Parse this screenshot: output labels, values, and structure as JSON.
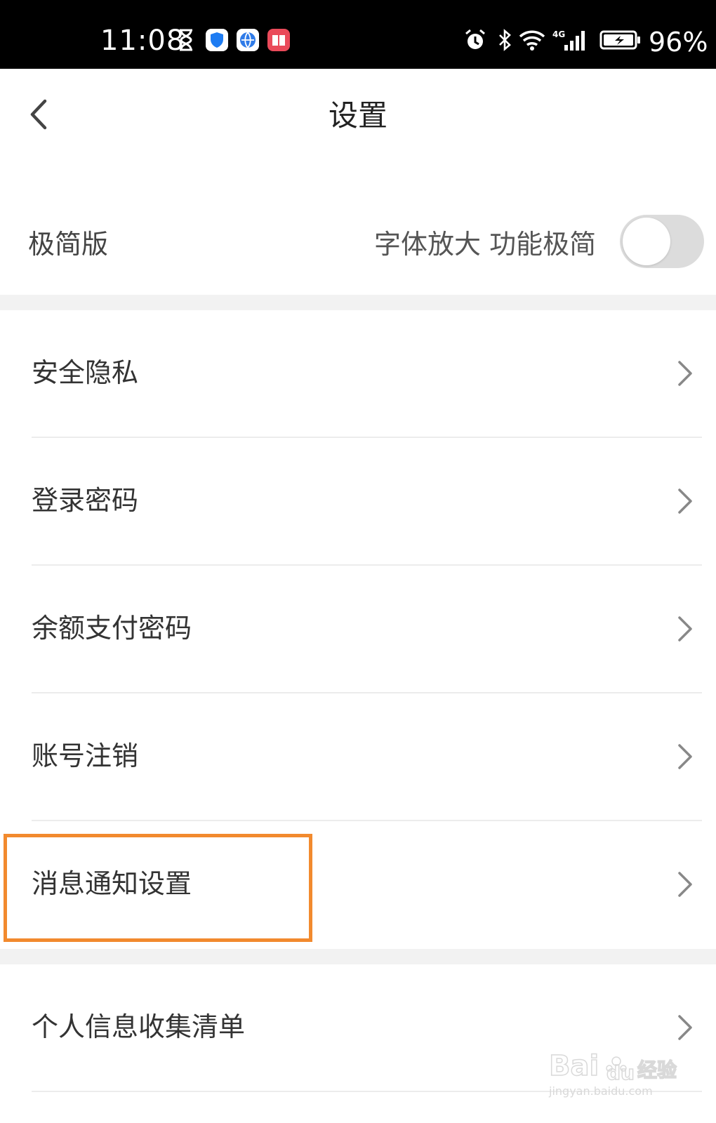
{
  "status_bar": {
    "time": "11:08",
    "battery_percent": "96%",
    "icons_left": [
      "hourglass-icon",
      "shield-app-icon",
      "browser-app-icon",
      "book-app-icon"
    ],
    "icons_right": [
      "alarm-icon",
      "bluetooth-icon",
      "wifi-icon",
      "4g-signal-icon",
      "battery-charging-icon"
    ]
  },
  "header": {
    "title": "设置",
    "back_icon": "chevron-left-icon"
  },
  "simple_mode": {
    "label": "极简版",
    "description": "字体放大 功能极简",
    "toggle_on": false
  },
  "settings_list": [
    {
      "label": "安全隐私"
    },
    {
      "label": "登录密码"
    },
    {
      "label": "余额支付密码"
    },
    {
      "label": "账号注销"
    },
    {
      "label": "消息通知设置",
      "highlighted": true
    }
  ],
  "settings_list_2": [
    {
      "label": "个人信息收集清单"
    }
  ],
  "colors": {
    "highlight": "#f28a2e",
    "toggle_off": "#dcdcdc",
    "section_gap": "#f2f2f2"
  }
}
